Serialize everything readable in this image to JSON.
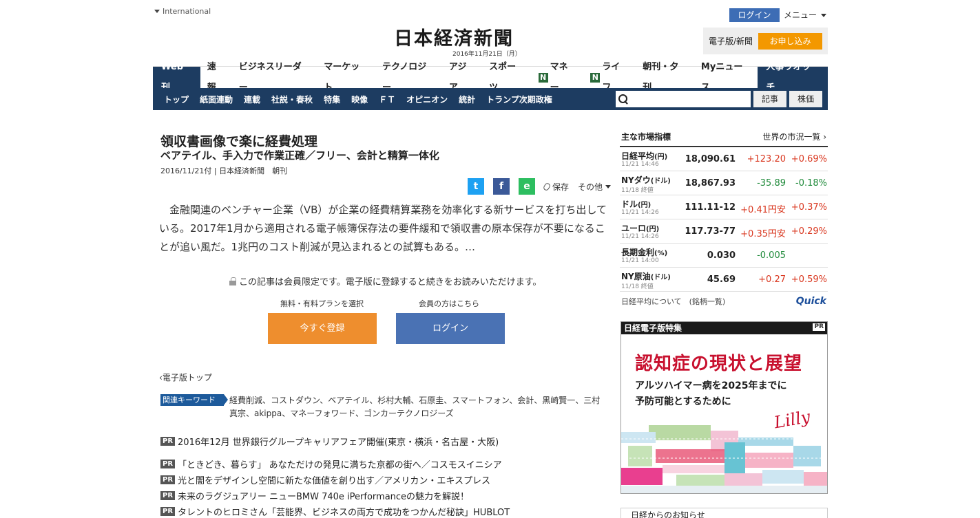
{
  "header": {
    "international": "International",
    "logo": "日本経済新聞",
    "date": "2016年11月21日（月）",
    "login": "ログイン",
    "menu": "メニュー",
    "edition_label": "電子版/新聞",
    "subscribe": "お申し込み"
  },
  "nav1": {
    "items": [
      "Web刊",
      "速報",
      "ビジネスリーダー",
      "マーケット",
      "テクノロジー",
      "アジア",
      "スポーツ",
      "マネー",
      "ライフ",
      "朝刊・夕刊",
      "Myニュース"
    ],
    "right": "人事ウオッチ",
    "n_badge": "N"
  },
  "nav2": {
    "items": [
      "トップ",
      "紙面連動",
      "連載",
      "社説・春秋",
      "特集",
      "映像",
      "ＦＴ",
      "オピニオン",
      "統計",
      "トランプ次期政権"
    ],
    "search_placeholder": "",
    "btn_article": "記事",
    "btn_stock": "株価"
  },
  "article": {
    "title": "領収書画像で楽に経費処理",
    "subtitle": "ベアテイル、手入力で作業正確／フリー、会計と精算一体化",
    "meta": "2016/11/21付 | 日本経済新聞　朝刊",
    "share_twitter": "t",
    "share_facebook": "f",
    "share_evernote": "e",
    "save": "保存",
    "more": "その他",
    "body": "金融関連のベンチャー企業（VB）が企業の経費精算業務を効率化する新サービスを打ち出している。2017年1月から適用される電子帳簿保存法の要件緩和で領収書の原本保存が不要になることが追い風だ。1兆円のコスト削減が見込まれるとの試算もある。…",
    "member_note": "この記事は会員限定です。電子版に登録すると続きをお読みいただけます。",
    "plan_label": "無料・有料プランを選択",
    "member_label": "会員の方はこちら",
    "register": "今すぐ登録",
    "login": "ログイン",
    "back": "電子版トップ",
    "keyword_label": "関連キーワード",
    "keywords": "経費削減、コストダウン、ベアテイル、杉村大輔、石原圭、スマートフォン、会計、黒崎賢一、三村真宗、akippa、マネーフォワード、ゴンカーテクノロジーズ"
  },
  "pr": [
    "2016年12月 世界銀行グループキャリアフェア開催(東京・横浜・名古屋・大阪)",
    "「ときどき、暮らす」 あなただけの発見に満ちた京都の街へ／コスモスイニシア",
    "光と闇をデザインし空間に新たな価値を創り出す／アメリカン・エキスプレス",
    "未来のラグジュアリー ニューBMW 740e iPerformanceの魅力を解説！",
    "タレントのヒロミさん「芸能界、ビジネスの両方で成功をつかんだ秘訣」HUBLOT"
  ],
  "pr_tag": "PR",
  "market": {
    "title": "主な市場指標",
    "world": "世界の市況一覧",
    "rows": [
      {
        "name": "日経平均",
        "unit": "(円)",
        "time": "11/21 14:46",
        "value": "18,090.61",
        "chg": "+123.20",
        "pct": "+0.69%",
        "dir1": "up",
        "dir2": "up"
      },
      {
        "name": "NYダウ",
        "unit": "(ドル)",
        "time": "11/18 終値",
        "value": "18,867.93",
        "chg": "-35.89",
        "pct": "-0.18%",
        "dir1": "down",
        "dir2": "down"
      },
      {
        "name": "ドル",
        "unit": "(円)",
        "time": "11/21 14:26",
        "value": "111.11-12",
        "chg": "+0.41円安",
        "pct": "+0.37%",
        "dir1": "up",
        "dir2": "up"
      },
      {
        "name": "ユーロ",
        "unit": "(円)",
        "time": "11/21 14:26",
        "value": "117.73-77",
        "chg": "+0.35円安",
        "pct": "+0.29%",
        "dir1": "up",
        "dir2": "up"
      },
      {
        "name": "長期金利",
        "unit": "(%)",
        "time": "11/21 14:00",
        "value": "0.030",
        "chg": "-0.005",
        "pct": "",
        "dir1": "down",
        "dir2": "down"
      },
      {
        "name": "NY原油",
        "unit": "(ドル)",
        "time": "11/18 終値",
        "value": "45.69",
        "chg": "+0.27",
        "pct": "+0.59%",
        "dir1": "up",
        "dir2": "up"
      }
    ],
    "footer": "日経平均について　(銘柄一覧)",
    "quick": "Quick"
  },
  "ad": {
    "header": "日経電子版特集",
    "pr": "PR",
    "title": "認知症の現状と展望",
    "sub1": "アルツハイマー病を2025年までに",
    "sub2": "予防可能とするために",
    "brand": "Lilly"
  },
  "notice": "日経からのお知らせ",
  "colors": {
    "navy": "#1d3c61",
    "orange": "#f39800",
    "blue": "#4a72b4",
    "up": "#d9361e",
    "down": "#1f8a3a"
  }
}
